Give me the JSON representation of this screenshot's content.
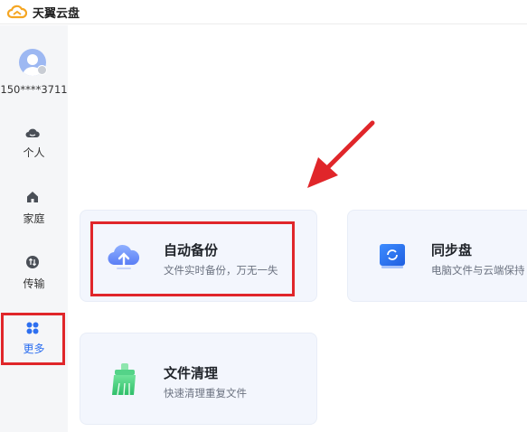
{
  "app": {
    "title": "天翼云盘"
  },
  "user": {
    "id": "150****3711"
  },
  "sidebar": {
    "items": [
      {
        "label": "个人",
        "icon": "cloud-icon",
        "active": false
      },
      {
        "label": "家庭",
        "icon": "home-icon",
        "active": false
      },
      {
        "label": "传输",
        "icon": "transfer-icon",
        "active": false
      },
      {
        "label": "更多",
        "icon": "grid-icon",
        "active": true
      }
    ]
  },
  "cards": [
    {
      "title": "自动备份",
      "desc": "文件实时备份，万无一失",
      "icon": "cloud-upload-icon"
    },
    {
      "title": "同步盘",
      "desc": "电脑文件与云端保持",
      "icon": "sync-folder-icon"
    },
    {
      "title": "文件清理",
      "desc": "快速清理重复文件",
      "icon": "cleanup-icon"
    }
  ],
  "colors": {
    "accent": "#2d6ff0",
    "highlight": "#e0262a",
    "sidebar_bg": "#f5f6f8",
    "card_bg": "#f3f6fd"
  }
}
